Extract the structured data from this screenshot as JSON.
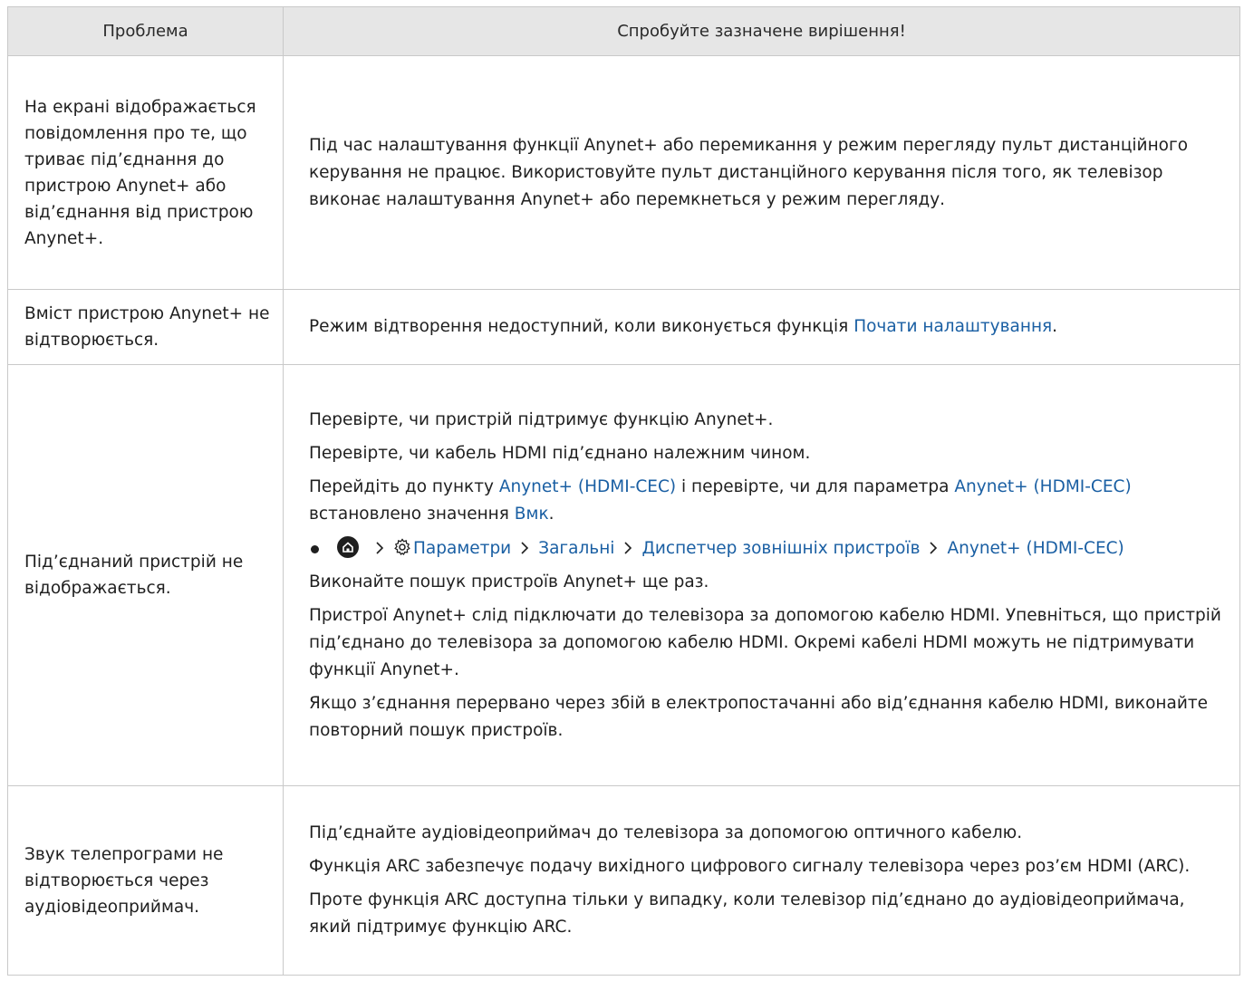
{
  "header": {
    "col1": "Проблема",
    "col2": "Спробуйте зазначене вирішення!"
  },
  "row1": {
    "problem": "На екрані відображається повідомлення про те, що триває під’єднання до пристрою Anynet+ або від’єднання від пристрою Anynet+.",
    "solution": "Під час налаштування функції Anynet+ або перемикання у режим перегляду пульт дистанційного керування не працює. Використовуйте пульт дистанційного керування після того, як телевізор виконає налаштування Anynet+ або перемкнеться у режим перегляду."
  },
  "row2": {
    "problem": "Вміст пристрою Anynet+ не відтворюється.",
    "solution_pre": "Режим відтворення недоступний, коли виконується функція ",
    "solution_link": "Почати налаштування",
    "solution_post": "."
  },
  "row3": {
    "problem": "Під’єднаний пристрій не відображається.",
    "p1": "Перевірте, чи пристрій підтримує функцію Anynet+.",
    "p2": "Перевірте, чи кабель HDMI під’єднано належним чином.",
    "p3_a": "Перейдіть до пункту ",
    "p3_link1": "Anynet+ (HDMI-CEC)",
    "p3_b": " і перевірте, чи для параметра ",
    "p3_link2": "Anynet+ (HDMI-CEC)",
    "p3_c": " встановлено значення ",
    "p3_link3": "Вмк",
    "p3_d": ".",
    "path": {
      "settings": "Параметри",
      "general": "Загальні",
      "device_manager": "Диспетчер зовнішніх пристроїв",
      "anynet": "Anynet+ (HDMI-CEC)",
      "icons": [
        "home-icon",
        "gear-icon",
        "chevron-right-icon"
      ]
    },
    "p4": "Виконайте пошук пристроїв Anynet+ ще раз.",
    "p5": "Пристрої Anynet+ слід підключати до телевізора за допомогою кабелю HDMI. Упевніться, що пристрій під’єднано до телевізора за допомогою кабелю HDMI. Окремі кабелі HDMI можуть не підтримувати функції Anynet+.",
    "p6": "Якщо з’єднання перервано через збій в електропостачанні або від’єднання кабелю HDMI, виконайте повторний пошук пристроїв."
  },
  "row4": {
    "problem": "Звук телепрограми не відтворюється через аудіовідеоприймач.",
    "p1": "Під’єднайте аудіовідеоприймач до телевізора за допомогою оптичного кабелю.",
    "p2": "Функція ARC забезпечує подачу вихідного цифрового сигналу телевізора через роз’єм HDMI (ARC).",
    "p3": "Проте функція ARC доступна тільки у випадку, коли телевізор під’єднано до аудіовідеоприймача, який підтримує функцію ARC."
  },
  "colors": {
    "link": "#1a5fa3",
    "header_bg": "#e6e6e6",
    "border": "#c9c9c9",
    "text": "#1f1f1f"
  }
}
